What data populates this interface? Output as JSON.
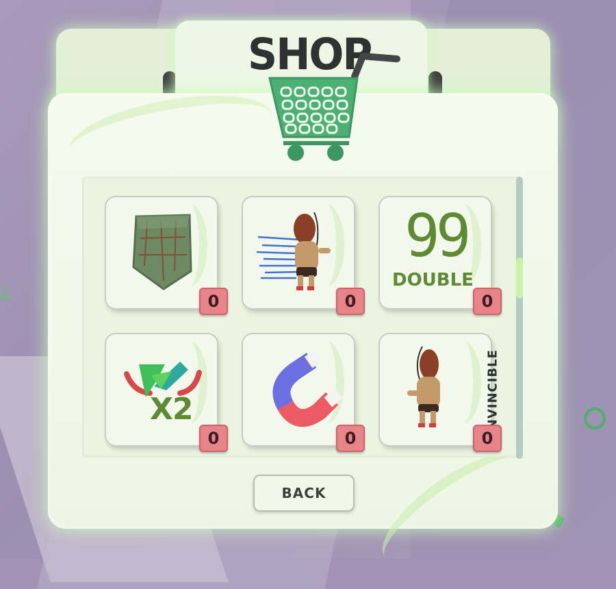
{
  "shop": {
    "title": "SHOP",
    "back_label": "BACK",
    "items": [
      {
        "name": "shield",
        "count": "0",
        "art_text": ""
      },
      {
        "name": "speed-boost",
        "count": "0",
        "art_text": ""
      },
      {
        "name": "double-score",
        "count": "0",
        "art_text": "99",
        "art_caption": "DOUBLE"
      },
      {
        "name": "x2-multiplier",
        "count": "0",
        "art_text": "X2"
      },
      {
        "name": "magnet",
        "count": "0",
        "art_text": ""
      },
      {
        "name": "invincible",
        "count": "0",
        "art_caption": "INVINCIBLE"
      }
    ]
  },
  "colors": {
    "accent_green": "#5e8a34",
    "cart_green": "#4caf73",
    "count_badge": "#e8838a",
    "panel": "#f4faee"
  },
  "icons": [
    "cart-icon",
    "shield-icon",
    "runner-icon",
    "magnet-icon",
    "x2-icon",
    "invincible-runner-icon"
  ]
}
